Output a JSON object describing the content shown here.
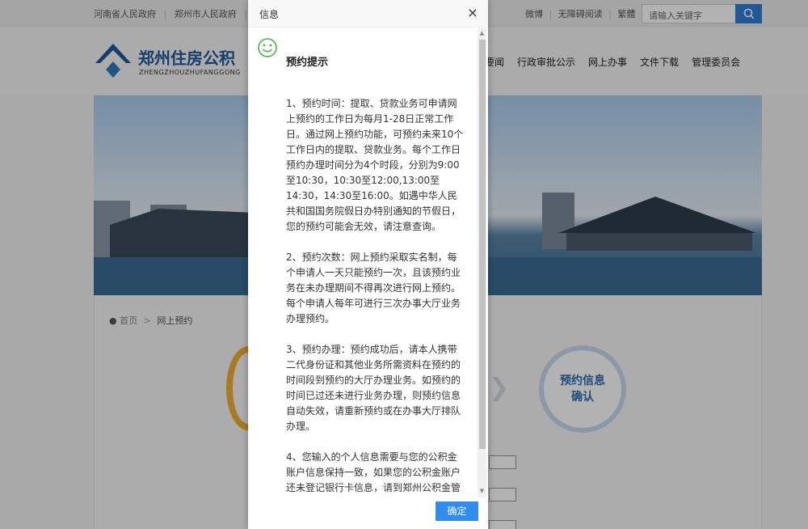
{
  "topbar": {
    "links": [
      "河南省人民政府",
      "|",
      "郑州市人民政府",
      "|"
    ],
    "right_links": [
      "微博",
      "|",
      "无障碍阅读",
      "|",
      "繁體"
    ],
    "search_placeholder": "请输入关键字"
  },
  "header": {
    "logo_title": "郑州住房公积",
    "logo_sub": "ZHENGZHOUZHUFANGGONG",
    "nav": [
      "要闻",
      "行政审批公示",
      "网上办事",
      "文件下载",
      "管理委员会"
    ]
  },
  "breadcrumb": {
    "home": "首页",
    "sep": ">",
    "current": "网上预约"
  },
  "steps": {
    "right_line1": "预约信息",
    "right_line2": "确认"
  },
  "modal": {
    "title": "信息",
    "close": "×",
    "tip_title": "预约提示",
    "paragraphs": [
      "1、预约时间：提取、贷款业务可申请网上预约的工作日为每月1-28日正常工作日。通过网上预约功能，可预约未来10个工作日内的提取、贷款业务。每个工作日预约办理时间分为4个时段，分别为9:00至10:30，10:30至12:00,13:00至14:30，14:30至16:00。如遇中华人民共和国国务院假日办特别通知的节假日，您的预约可能会无效，请注意查询。",
      "2、预约次数：网上预约采取实名制，每个申请人一天只能预约一次，且该预约业务在未办理期间不得再次进行网上预约。每个申请人每年可进行三次办事大厅业务办理预约。",
      "3、预约办理：预约成功后，请本人携带二代身份证和其他业务所需资料在预约的时间段到预约的大厅办理业务。如预约的时间已过还未进行业务办理，则预约信息自动失效，请重新预约或在办事大厅排队办理。",
      "4、您输入的个人信息需要与您的公积金账户信息保持一致，如果您的公积金账户还未登记银行卡信息，请到郑州公积金管"
    ],
    "ok_label": "确定"
  }
}
